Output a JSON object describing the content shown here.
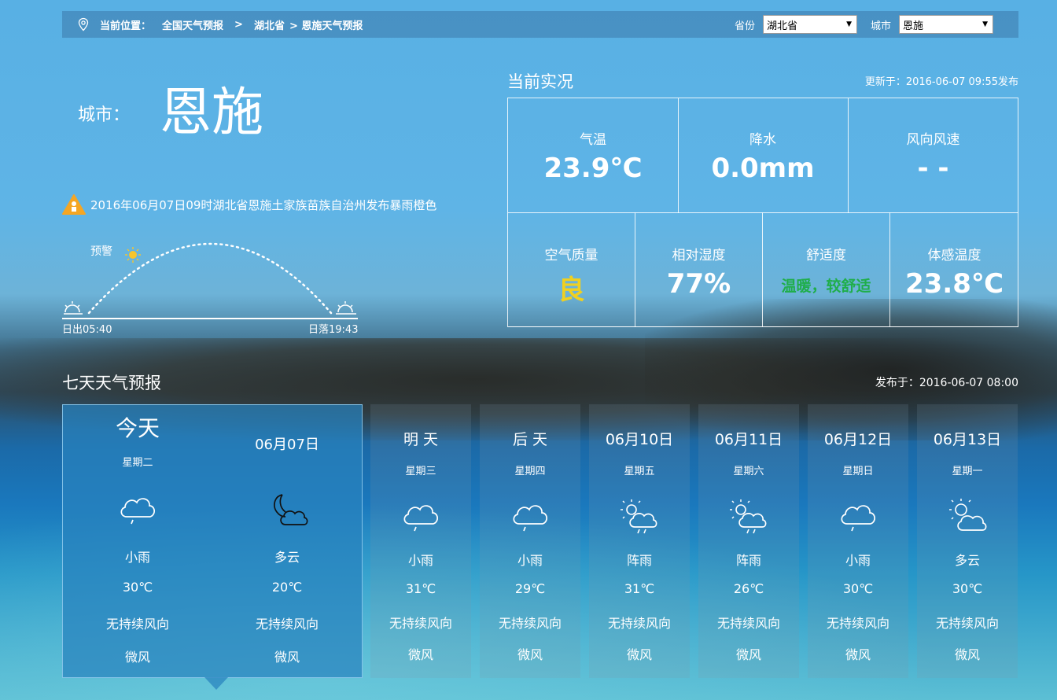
{
  "breadcrumb": {
    "prefix": "当前位置：",
    "national": "全国天气预报",
    "sep1": ">",
    "province": "湖北省",
    "current": "> 恩施天气预报"
  },
  "selectors": {
    "province_label": "省份",
    "province_value": "湖北省",
    "city_label": "城市",
    "city_value": "恩施"
  },
  "city": {
    "label": "城市：",
    "name": "恩施"
  },
  "warning": {
    "text": "2016年06月07日09时湖北省恩施土家族苗族自治州发布暴雨橙色",
    "marker_label": "预警",
    "icon_color": "#f5a623"
  },
  "sun": {
    "sunrise": "日出05:40",
    "sunset": "日落19:43"
  },
  "current": {
    "title": "当前实况",
    "updated": "更新于：2016-06-07 09:55发布",
    "temp_label": "气温",
    "temp": "23.9℃",
    "precip_label": "降水",
    "precip": "0.0mm",
    "wind_label": "风向风速",
    "wind": "- -",
    "aqi_label": "空气质量",
    "aqi": "良",
    "aqi_color": "#f0d020",
    "humidity_label": "相对湿度",
    "humidity": "77%",
    "comfort_label": "舒适度",
    "comfort": "温暖，较舒适",
    "comfort_color": "#1fae4a",
    "feels_label": "体感温度",
    "feels": "23.8℃"
  },
  "forecast": {
    "title": "七天天气预报",
    "published": "发布于：2016-06-07 08:00",
    "today": {
      "day": {
        "name": "今天",
        "week": "星期二",
        "icon": "cloud-rain-icon",
        "desc": "小雨",
        "temp": "30℃",
        "wind_dir": "无持续风向",
        "wind_speed": "微风"
      },
      "night": {
        "name": "06月07日",
        "icon": "moon-cloud-icon",
        "desc": "多云",
        "temp": "20℃",
        "wind_dir": "无持续风向",
        "wind_speed": "微风"
      }
    },
    "days": [
      {
        "name": "明 天",
        "week": "星期三",
        "icon": "cloud-rain-icon",
        "desc": "小雨",
        "temp": "31℃",
        "wind_dir": "无持续风向",
        "wind_speed": "微风"
      },
      {
        "name": "后 天",
        "week": "星期四",
        "icon": "cloud-rain-icon",
        "desc": "小雨",
        "temp": "29℃",
        "wind_dir": "无持续风向",
        "wind_speed": "微风"
      },
      {
        "name": "06月10日",
        "week": "星期五",
        "icon": "sun-cloud-rain-icon",
        "desc": "阵雨",
        "temp": "31℃",
        "wind_dir": "无持续风向",
        "wind_speed": "微风"
      },
      {
        "name": "06月11日",
        "week": "星期六",
        "icon": "sun-cloud-rain-icon",
        "desc": "阵雨",
        "temp": "26℃",
        "wind_dir": "无持续风向",
        "wind_speed": "微风"
      },
      {
        "name": "06月12日",
        "week": "星期日",
        "icon": "cloud-rain-icon",
        "desc": "小雨",
        "temp": "30℃",
        "wind_dir": "无持续风向",
        "wind_speed": "微风"
      },
      {
        "name": "06月13日",
        "week": "星期一",
        "icon": "sun-cloud-icon",
        "desc": "多云",
        "temp": "30℃",
        "wind_dir": "无持续风向",
        "wind_speed": "微风"
      }
    ]
  }
}
